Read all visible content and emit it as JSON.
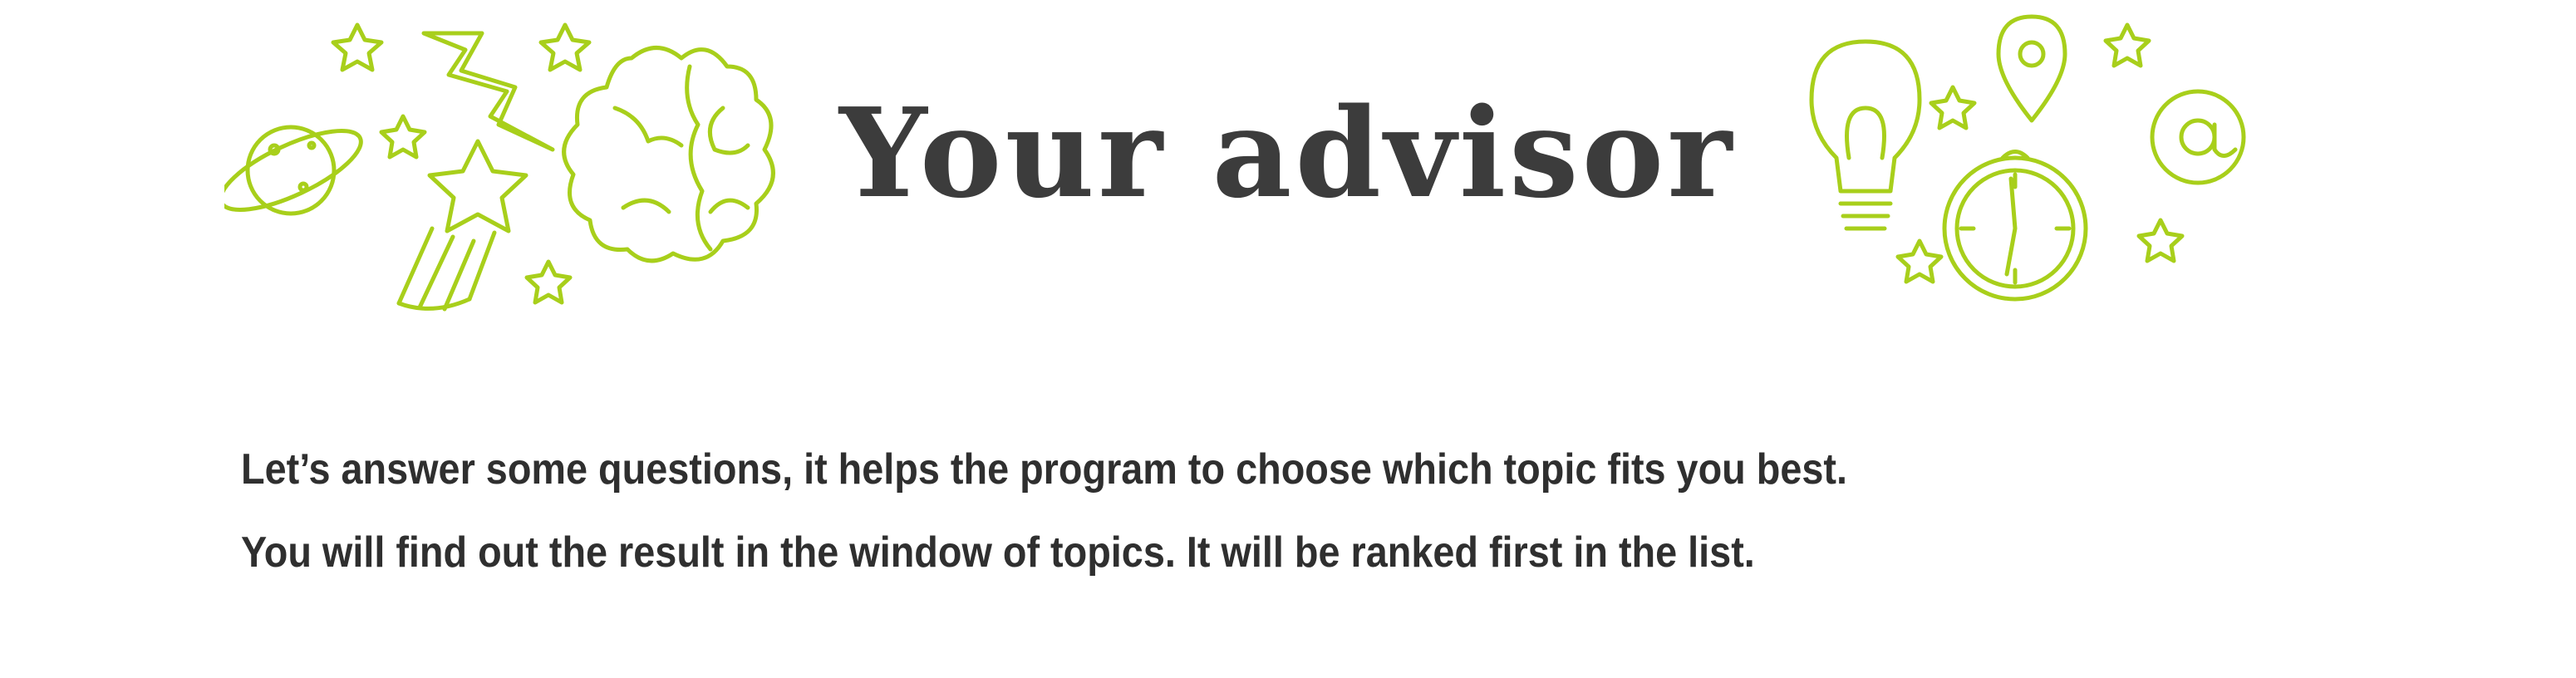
{
  "banner": {
    "title": "Your advisor",
    "accent_color": "#a8cf1b",
    "text_color": "#3c3c3c",
    "left_doodles": [
      "planet-icon",
      "lightning-icon",
      "shooting-star-icon",
      "brain-icon",
      "star-icon"
    ],
    "right_doodles": [
      "lightbulb-icon",
      "location-pin-icon",
      "clock-icon",
      "at-sign-icon",
      "star-icon"
    ]
  },
  "intro": {
    "line1": "Let’s answer some questions, it helps the program to choose which topic fits you best.",
    "line2": "You will find out the result in the window of topics. It will be ranked first in the list."
  }
}
